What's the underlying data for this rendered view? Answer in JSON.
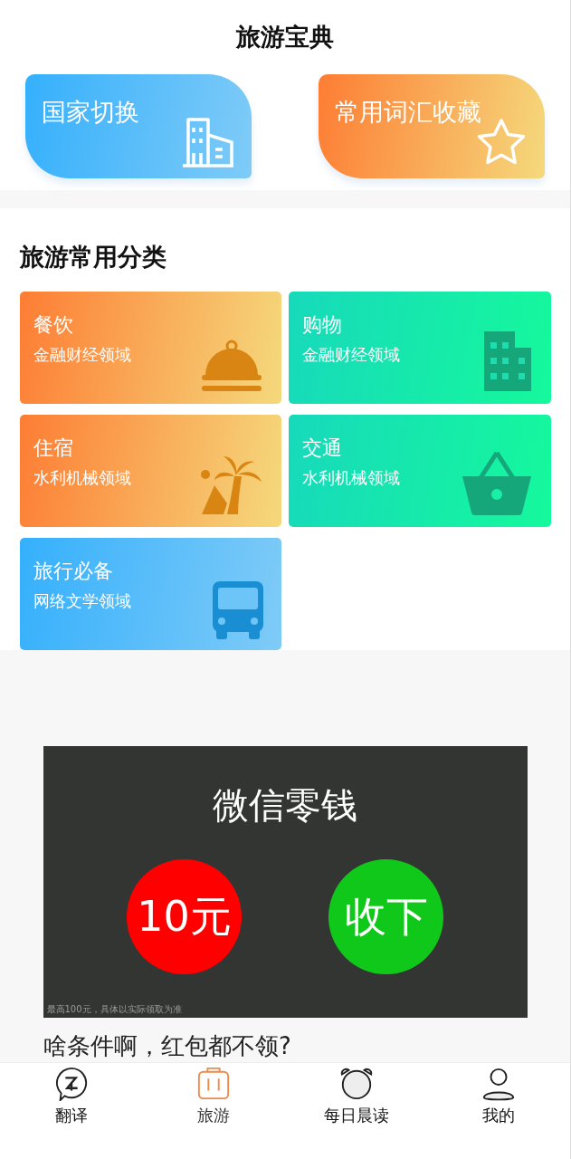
{
  "header": {
    "title": "旅游宝典"
  },
  "feature_cards": [
    {
      "label": "国家切换",
      "kind": "blue"
    },
    {
      "label": "常用词汇收藏",
      "kind": "orange"
    }
  ],
  "categories_section": {
    "title": "旅游常用分类",
    "items": [
      {
        "title": "餐饮",
        "subtitle": "金融财经领域",
        "kind": "orange"
      },
      {
        "title": "购物",
        "subtitle": "金融财经领域",
        "kind": "green"
      },
      {
        "title": "住宿",
        "subtitle": "水利机械领域",
        "kind": "orange"
      },
      {
        "title": "交通",
        "subtitle": "水利机械领域",
        "kind": "green"
      },
      {
        "title": "旅行必备",
        "subtitle": "网络文学领域",
        "kind": "blue"
      }
    ]
  },
  "ad": {
    "title": "微信零钱",
    "amount": "10元",
    "accept": "收下",
    "fine_print": "最高100元，具体以实际领取为准",
    "caption": "啥条件啊，红包都不领?"
  },
  "bottom_nav": [
    {
      "label": "翻译",
      "selected": false
    },
    {
      "label": "旅游",
      "selected": true
    },
    {
      "label": "每日晨读",
      "selected": false
    },
    {
      "label": "我的",
      "selected": false
    }
  ]
}
